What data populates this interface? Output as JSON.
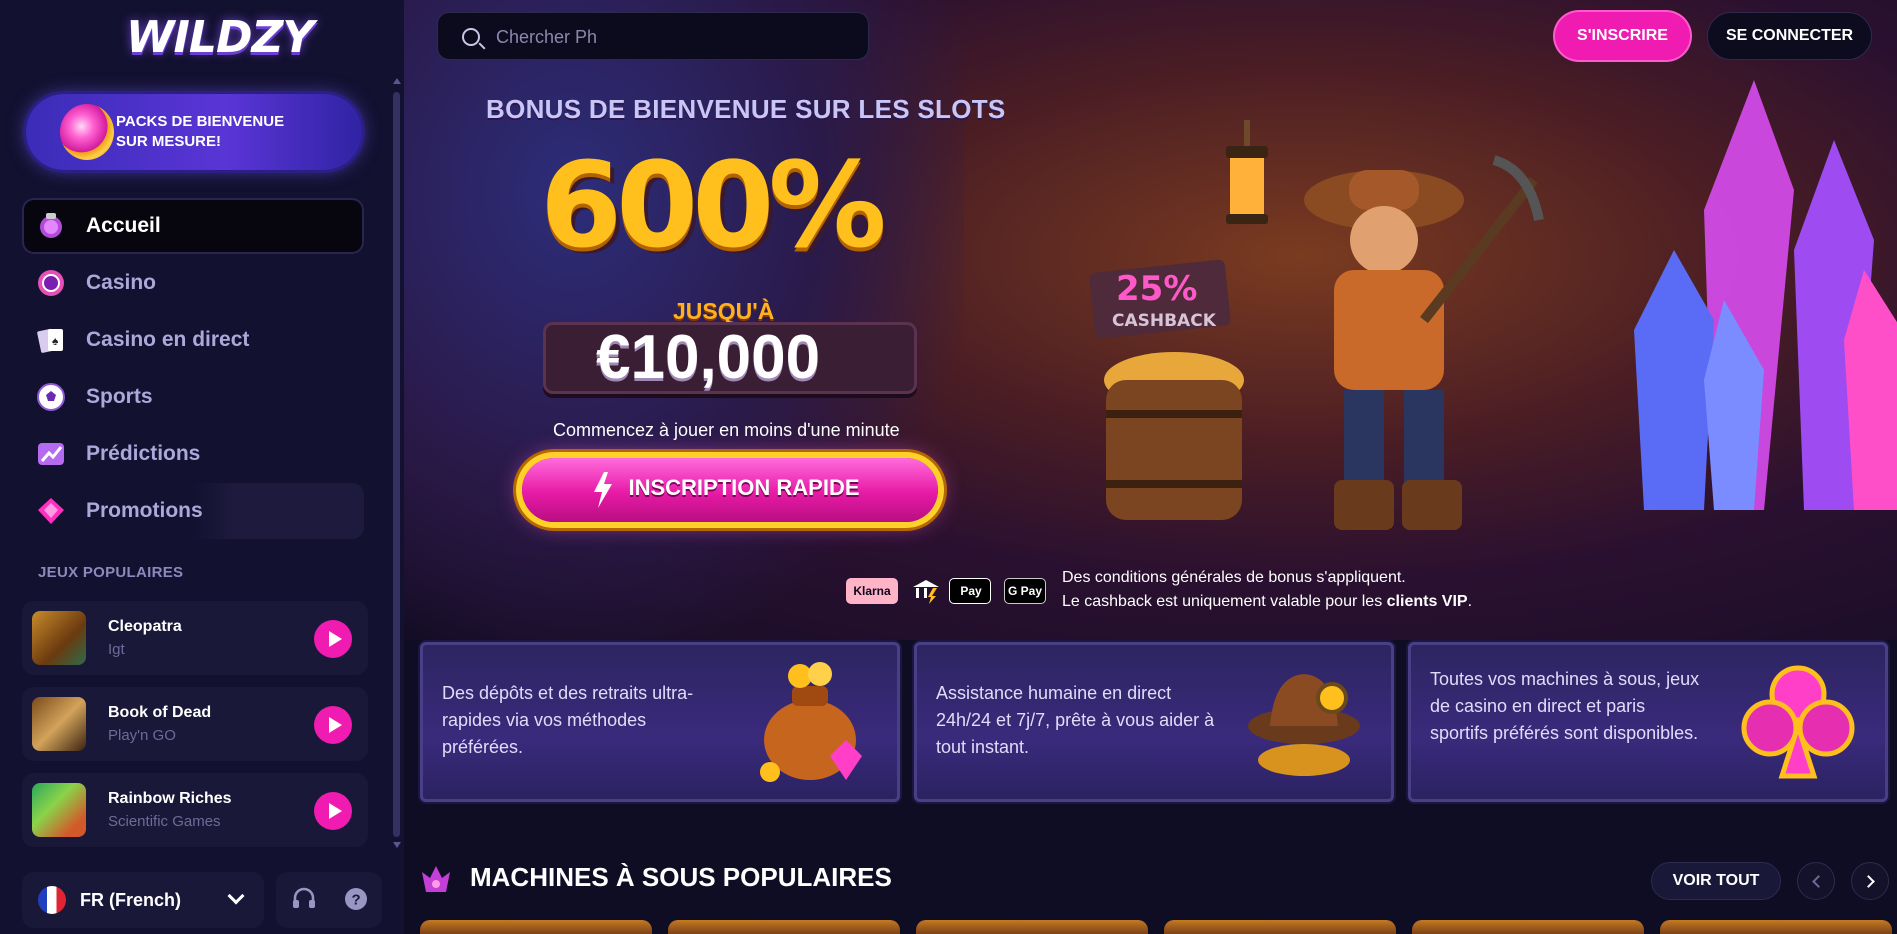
{
  "brand": {
    "logo_text": "WILDZY"
  },
  "sidebar": {
    "welcome_pack": "PACKS DE BIENVENUE SUR MESURE!",
    "nav": [
      {
        "label": "Accueil",
        "icon": "home-orb-icon"
      },
      {
        "label": "Casino",
        "icon": "casino-chip-icon"
      },
      {
        "label": "Casino en direct",
        "icon": "cards-icon"
      },
      {
        "label": "Sports",
        "icon": "soccer-ball-icon"
      },
      {
        "label": "Prédictions",
        "icon": "chart-arrow-icon"
      },
      {
        "label": "Promotions",
        "icon": "diamond-icon"
      }
    ],
    "popular_title": "JEUX POPULAIRES",
    "games": [
      {
        "name": "Cleopatra",
        "provider": "Igt"
      },
      {
        "name": "Book of Dead",
        "provider": "Play'n GO"
      },
      {
        "name": "Rainbow Riches",
        "provider": "Scientific Games"
      }
    ],
    "language": "FR (French)"
  },
  "header": {
    "search_placeholder": "Chercher Ph",
    "signup": "S'INSCRIRE",
    "login": "SE CONNECTER"
  },
  "hero": {
    "title": "BONUS DE BIENVENUE SUR LES SLOTS",
    "percent": "600%",
    "upto": "JUSQU'À",
    "amount": "€10,000",
    "cashback_sign": "25% CASHBACK",
    "subtitle": "Commencez à jouer en moins d'une minute",
    "cta": "INSCRIPTION RAPIDE",
    "payments": {
      "klarna": "Klarna",
      "apple": "Pay",
      "gpay": "G Pay"
    },
    "terms_line1": "Des conditions générales de bonus s'appliquent.",
    "terms_line2_prefix": "Le cashback est uniquement valable pour les ",
    "terms_line2_bold": "clients VIP",
    "terms_line2_suffix": "."
  },
  "features": [
    {
      "text": "Des dépôts et des retraits ultra-rapides via vos méthodes préférées."
    },
    {
      "text": "Assistance humaine en direct 24h/24 et 7j/7, prête à vous aider à tout instant."
    },
    {
      "text": "Toutes vos machines à sous, jeux de casino en direct et paris sportifs préférés sont disponibles."
    }
  ],
  "slots": {
    "title": "MACHINES À SOUS POPULAIRES",
    "view_all": "VOIR TOUT"
  },
  "colors": {
    "accent": "#f01bb0",
    "bg": "#0f0d24",
    "sidebar": "#131130",
    "gold": "#ffc01e"
  }
}
